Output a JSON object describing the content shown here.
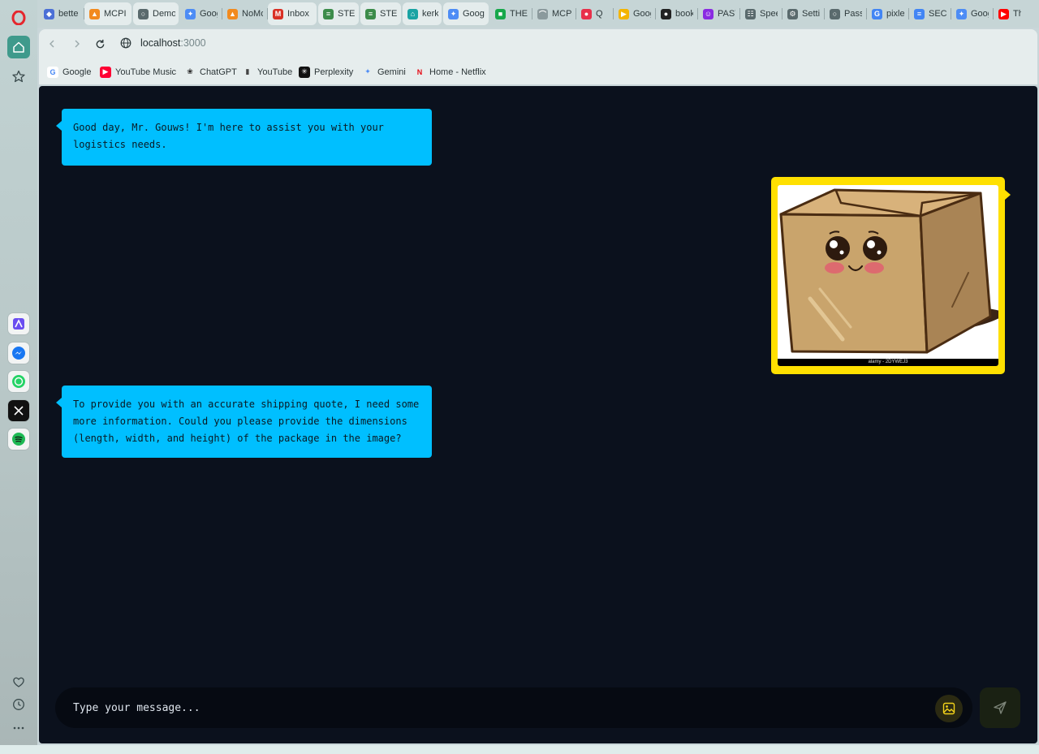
{
  "browser": {
    "tabs": [
      {
        "label": "bette",
        "icon": "shield-icon",
        "color": "#4b6fd6",
        "active": false
      },
      {
        "label": "MCPI",
        "icon": "fire-icon",
        "color": "#f28a1e",
        "active": true
      },
      {
        "label": "Demo",
        "icon": "globe-icon",
        "color": "#5a6a6d",
        "active": true
      },
      {
        "label": "Goog",
        "icon": "gemini-icon",
        "color": "#4d8cf5",
        "active": false
      },
      {
        "label": "NoMo",
        "icon": "fire-icon",
        "color": "#f28a1e",
        "active": false
      },
      {
        "label": "Inbox",
        "icon": "gmail-icon",
        "color": "#d93025",
        "active": true
      },
      {
        "label": "STEP",
        "icon": "doc-icon",
        "color": "#3c8c4a",
        "active": true
      },
      {
        "label": "STEP",
        "icon": "doc-icon",
        "color": "#3c8c4a",
        "active": true
      },
      {
        "label": "kerks",
        "icon": "home-icon",
        "color": "#1aa3a3",
        "active": true
      },
      {
        "label": "Goog",
        "icon": "gemini-icon",
        "color": "#4d8cf5",
        "active": true
      },
      {
        "label": "THE E",
        "icon": "green-box-icon",
        "color": "#17a84b",
        "active": false
      },
      {
        "label": "MCP",
        "icon": "arc-icon",
        "color": "#8b9a9d",
        "active": false
      },
      {
        "label": "Q",
        "icon": "music-icon",
        "color": "#e8304a",
        "active": false
      },
      {
        "label": "Goog",
        "icon": "meet-icon",
        "color": "#f4b400",
        "active": false
      },
      {
        "label": "book",
        "icon": "github-icon",
        "color": "#222222",
        "active": false
      },
      {
        "label": "PAST",
        "icon": "mask-icon",
        "color": "#8a2be2",
        "active": false
      },
      {
        "label": "Spee",
        "icon": "grid-icon",
        "color": "#5a6a6d",
        "active": false
      },
      {
        "label": "Settin",
        "icon": "gear-icon",
        "color": "#5a6a6d",
        "active": false
      },
      {
        "label": "Passw",
        "icon": "globe-icon",
        "color": "#5a6a6d",
        "active": false
      },
      {
        "label": "pixler",
        "icon": "google-icon",
        "color": "#4285f4",
        "active": false
      },
      {
        "label": "SECU",
        "icon": "docs-icon",
        "color": "#4285f4",
        "active": false
      },
      {
        "label": "Goog",
        "icon": "gemini-icon",
        "color": "#4d8cf5",
        "active": false
      },
      {
        "label": "The",
        "icon": "youtube-icon",
        "color": "#ff0000",
        "active": false
      }
    ],
    "url": {
      "host": "localhost",
      "port": ":3000"
    },
    "bookmarks": [
      {
        "label": "Google",
        "icon": "google-icon"
      },
      {
        "label": "YouTube Music",
        "icon": "youtube-music-icon"
      },
      {
        "label": "ChatGPT",
        "icon": "chatgpt-icon"
      },
      {
        "label": "YouTube",
        "icon": "file-icon"
      },
      {
        "label": "Perplexity",
        "icon": "perplexity-icon"
      },
      {
        "label": "Gemini",
        "icon": "gemini-icon"
      },
      {
        "label": "Home - Netflix",
        "icon": "netflix-icon"
      }
    ]
  },
  "chat": {
    "messages": [
      {
        "sender": "bot",
        "text": "Good day, Mr. Gouws! I'm here to assist you with your logistics needs."
      },
      {
        "sender": "user",
        "type": "image",
        "caption": "alamy - 2DYWEJ3"
      },
      {
        "sender": "bot",
        "text": "To provide you with an accurate shipping quote, I need some more information. Could you please provide the dimensions (length, width, and height) of the package in the image?"
      }
    ],
    "input": {
      "placeholder": "Type your message..."
    }
  },
  "colors": {
    "bot_bubble": "#00bfff",
    "user_bubble": "#ffe000",
    "chat_background": "#0b111d"
  }
}
